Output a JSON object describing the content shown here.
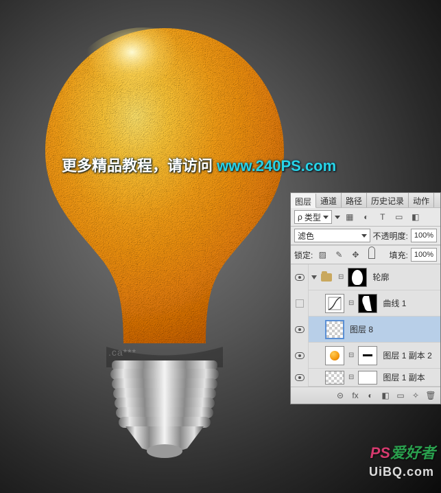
{
  "promo": {
    "text1": "更多精品教程，请访问 ",
    "text2": "www.240PS.com"
  },
  "watermarks": {
    "ps": "PS",
    "aihao": "爱好者",
    "uibq": "UiBQ.com",
    "caixia": ".ca***"
  },
  "panel": {
    "tabs": [
      "图层",
      "通道",
      "路径",
      "历史记录",
      "动作"
    ],
    "active_tab": 0,
    "type_row": {
      "icon": "ρ",
      "type_label": "类型",
      "filter_icons": [
        "▦",
        "◐",
        "T",
        "▭",
        "◧"
      ]
    },
    "blend": {
      "mode": "滤色",
      "opacity_label": "不透明度:",
      "opacity": "100%"
    },
    "lock": {
      "label": "锁定:",
      "fill_label": "填充:",
      "fill": "100%"
    },
    "layers": [
      {
        "kind": "group",
        "name": "轮廓",
        "visible": true,
        "mask": "bulb"
      },
      {
        "kind": "adjust",
        "name": "曲线 1",
        "visible": false,
        "indent": 1,
        "mask": "curve"
      },
      {
        "kind": "pixel",
        "name": "图层 8",
        "visible": true,
        "indent": 1,
        "selected": true,
        "thumb": "checker"
      },
      {
        "kind": "pixel",
        "name": "图层 1 副本 2",
        "visible": true,
        "indent": 1,
        "thumb": "orange",
        "mask": "minus"
      },
      {
        "kind": "pixel",
        "name": "图层 1 副本",
        "visible": true,
        "indent": 1,
        "thumb": "checker-faint",
        "partial": true
      }
    ],
    "bottom_icons": [
      "⊝",
      "fx",
      "◐",
      "◧",
      "▭",
      "✧",
      "🗑"
    ]
  }
}
